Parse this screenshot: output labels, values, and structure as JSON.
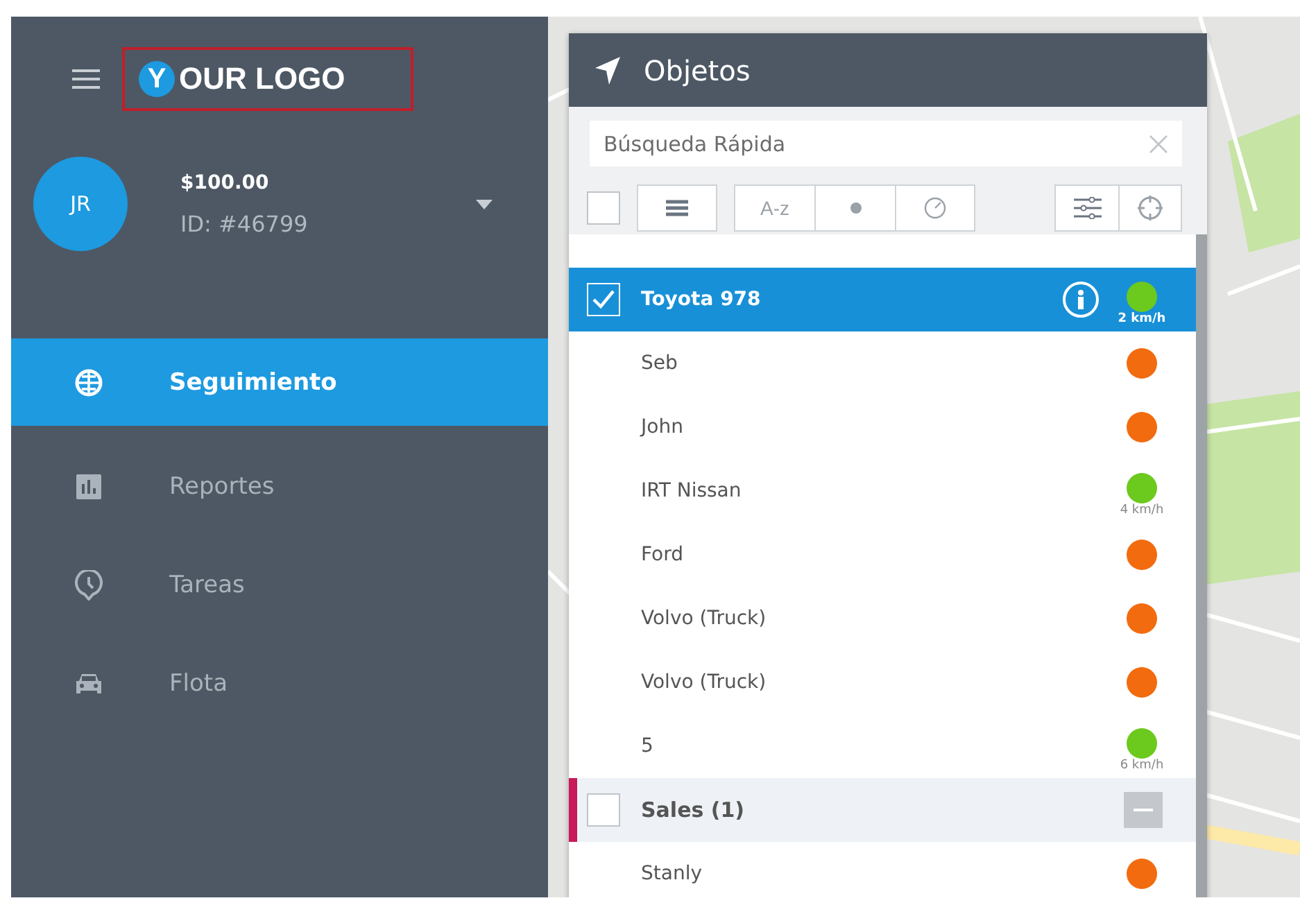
{
  "sidebar": {
    "logo": {
      "initial": "Y",
      "text": "OUR LOGO"
    },
    "user": {
      "initials": "JR",
      "balance": "$100.00",
      "id": "ID: #46799"
    },
    "items": [
      {
        "label": "Seguimiento",
        "kind": "globe",
        "selected": true
      },
      {
        "label": "Reportes",
        "kind": "chart",
        "selected": false
      },
      {
        "label": "Tareas",
        "kind": "clock",
        "selected": false
      },
      {
        "label": "Flota",
        "kind": "car",
        "selected": false
      }
    ]
  },
  "panel": {
    "title": "Objetos",
    "search": {
      "placeholder": "Búsqueda Rápida"
    },
    "toolbar": {
      "select_all_checked": false,
      "sort_label": "A-z"
    },
    "rows": [
      {
        "kind": "object",
        "name": "Toyota 978",
        "checked": true,
        "selected": true,
        "color": "#6cc91e",
        "speed": "2 km/h"
      },
      {
        "kind": "object",
        "name": "Seb",
        "selected": false,
        "color": "#f26b0f"
      },
      {
        "kind": "object",
        "name": "John",
        "selected": false,
        "color": "#f26b0f"
      },
      {
        "kind": "object",
        "name": "IRT Nissan",
        "selected": false,
        "color": "#6cc91e",
        "speed": "4 km/h"
      },
      {
        "kind": "object",
        "name": "Ford",
        "selected": false,
        "color": "#f26b0f"
      },
      {
        "kind": "object",
        "name": "Volvo (Truck)",
        "selected": false,
        "color": "#f26b0f"
      },
      {
        "kind": "object",
        "name": "Volvo (Truck)",
        "selected": false,
        "color": "#f26b0f"
      },
      {
        "kind": "object",
        "name": "5",
        "selected": false,
        "color": "#6cc91e",
        "speed": "6 km/h"
      },
      {
        "kind": "group",
        "name": "Sales (1)",
        "checked": false,
        "color": "#c8195a"
      },
      {
        "kind": "object",
        "name": "Stanly",
        "selected": false,
        "color": "#f26b0f"
      }
    ]
  }
}
